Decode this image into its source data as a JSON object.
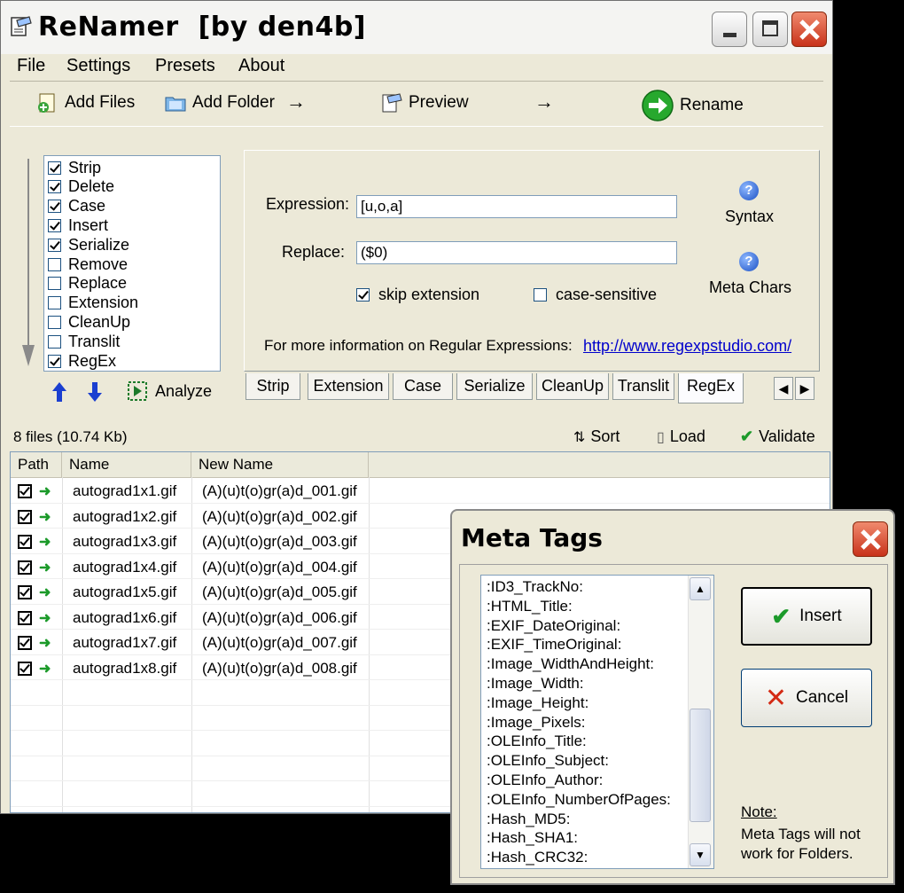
{
  "app": {
    "title": "ReNamer  [by den4b]",
    "icon": "renamer-app-icon",
    "window_buttons": [
      "minimize",
      "maximize",
      "close"
    ]
  },
  "menu": [
    "File",
    "Settings",
    "Presets",
    "About"
  ],
  "toolbar": {
    "add_files": "Add Files",
    "add_folder": "Add Folder",
    "preview": "Preview",
    "rename": "Rename",
    "arrow": "→"
  },
  "rules": [
    {
      "label": "Strip",
      "checked": true
    },
    {
      "label": "Delete",
      "checked": true
    },
    {
      "label": "Case",
      "checked": true
    },
    {
      "label": "Insert",
      "checked": true
    },
    {
      "label": "Serialize",
      "checked": true
    },
    {
      "label": "Remove",
      "checked": false
    },
    {
      "label": "Replace",
      "checked": false
    },
    {
      "label": "Extension",
      "checked": false
    },
    {
      "label": "CleanUp",
      "checked": false
    },
    {
      "label": "Translit",
      "checked": false
    },
    {
      "label": "RegEx",
      "checked": true
    }
  ],
  "rule_actions": {
    "analyze": "Analyze"
  },
  "regex": {
    "expression_label": "Expression:",
    "expression_value": "[u,o,a]",
    "replace_label": "Replace:",
    "replace_value": "($0)",
    "skip_extension": "skip extension",
    "skip_extension_checked": true,
    "case_sensitive": "case-sensitive",
    "case_sensitive_checked": false,
    "syntax": "Syntax",
    "meta_chars": "Meta Chars",
    "info_text": "For more information on Regular Expressions:",
    "info_link": "http://www.regexpstudio.com/"
  },
  "tabs": [
    "Strip",
    "Extension",
    "Case",
    "Serialize",
    "CleanUp",
    "Translit",
    "RegEx"
  ],
  "active_tab": "RegEx",
  "status": {
    "files_info": "8 files (10.74 Kb)",
    "sort": "Sort",
    "load": "Load",
    "validate": "Validate"
  },
  "table": {
    "columns": [
      "Path",
      "Name",
      "New Name"
    ],
    "rows": [
      {
        "name": "autograd1x1.gif",
        "new_name": "(A)(u)t(o)gr(a)d_001.gif"
      },
      {
        "name": "autograd1x2.gif",
        "new_name": "(A)(u)t(o)gr(a)d_002.gif"
      },
      {
        "name": "autograd1x3.gif",
        "new_name": "(A)(u)t(o)gr(a)d_003.gif"
      },
      {
        "name": "autograd1x4.gif",
        "new_name": "(A)(u)t(o)gr(a)d_004.gif"
      },
      {
        "name": "autograd1x5.gif",
        "new_name": "(A)(u)t(o)gr(a)d_005.gif"
      },
      {
        "name": "autograd1x6.gif",
        "new_name": "(A)(u)t(o)gr(a)d_006.gif"
      },
      {
        "name": "autograd1x7.gif",
        "new_name": "(A)(u)t(o)gr(a)d_007.gif"
      },
      {
        "name": "autograd1x8.gif",
        "new_name": "(A)(u)t(o)gr(a)d_008.gif"
      }
    ]
  },
  "meta_dialog": {
    "title": "Meta Tags",
    "items": [
      ":ID3_TrackNo:",
      ":HTML_Title:",
      ":EXIF_DateOriginal:",
      ":EXIF_TimeOriginal:",
      ":Image_WidthAndHeight:",
      ":Image_Width:",
      ":Image_Height:",
      ":Image_Pixels:",
      ":OLEInfo_Title:",
      ":OLEInfo_Subject:",
      ":OLEInfo_Author:",
      ":OLEInfo_NumberOfPages:",
      ":Hash_MD5:",
      ":Hash_SHA1:",
      ":Hash_CRC32:"
    ],
    "insert": "Insert",
    "cancel": "Cancel",
    "note_heading": "Note:",
    "note_text": "Meta Tags will not work for Folders."
  },
  "colors": {
    "window_bg": "#ece9d8",
    "link": "#0000cc",
    "close_red": "#c8321a",
    "check_green": "#1c9a2a"
  }
}
